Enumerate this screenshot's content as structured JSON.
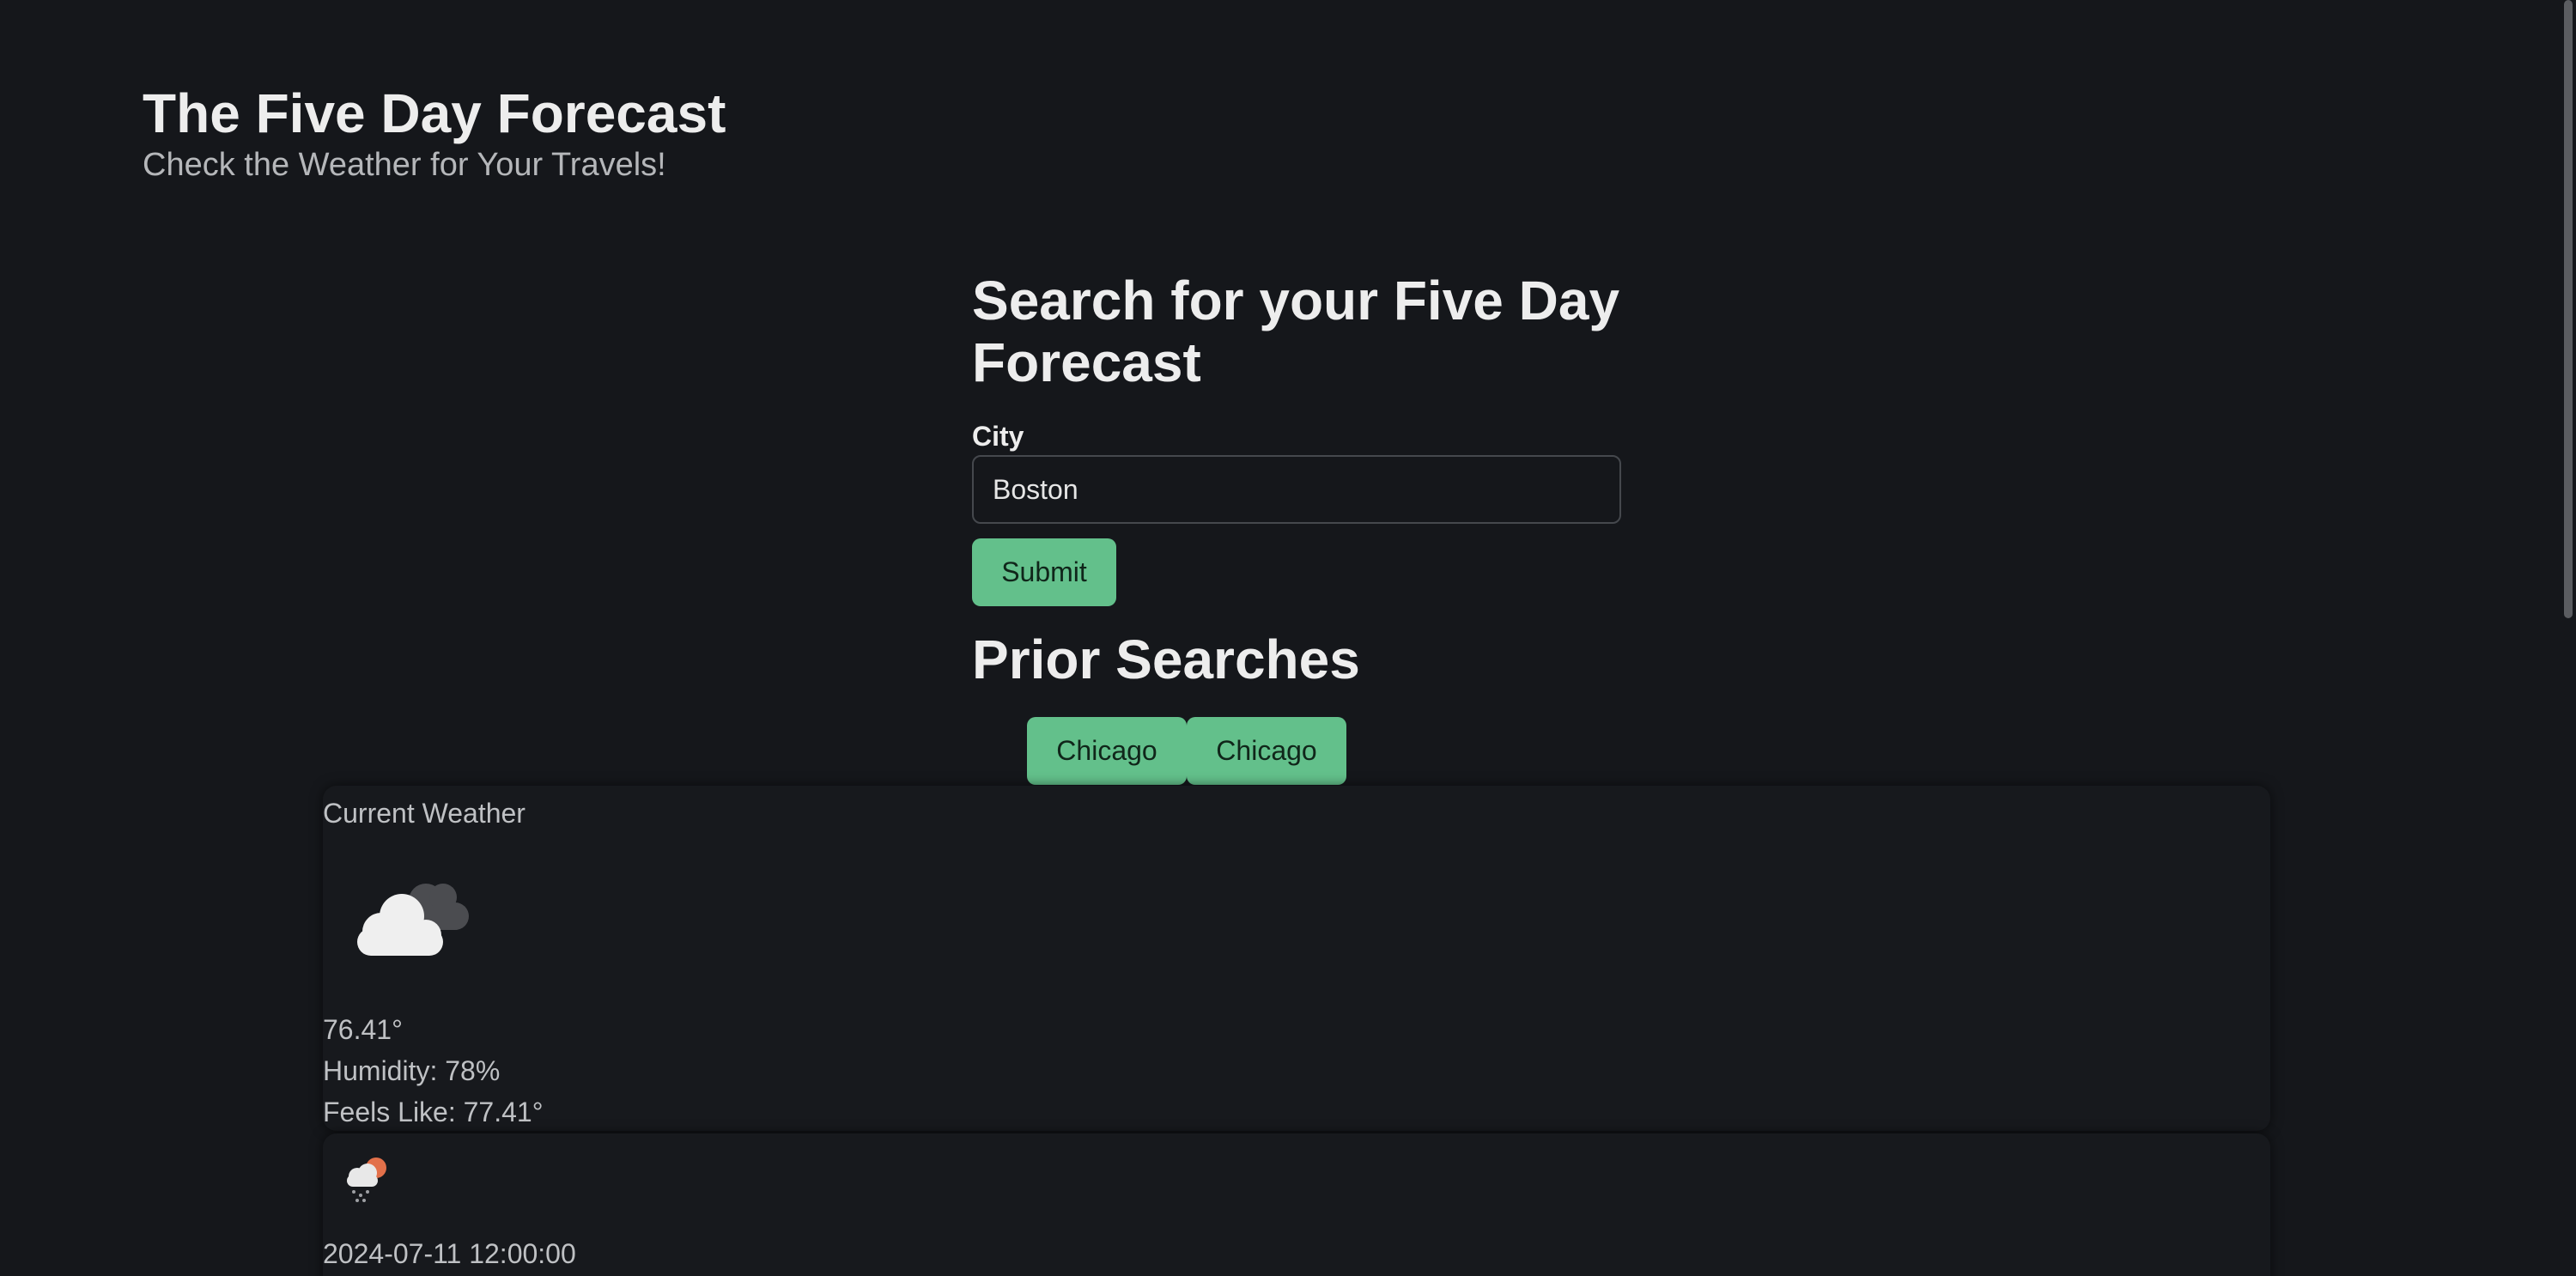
{
  "header": {
    "title": "The Five Day Forecast",
    "subtitle": "Check the Weather for Your Travels!"
  },
  "search": {
    "heading": "Search for your Five Day Forecast",
    "city_label": "City",
    "city_value": "Boston",
    "submit_label": "Submit"
  },
  "prior_searches": {
    "heading": "Prior Searches",
    "items": [
      "Chicago",
      "Chicago"
    ]
  },
  "current_weather": {
    "title": "Current Weather",
    "icon": "cloudy-icon",
    "temperature": "76.41°",
    "humidity": "Humidity: 78%",
    "feels_like": "Feels Like: 77.41°"
  },
  "forecast": [
    {
      "icon": "rain-sun-icon",
      "datetime": "2024-07-11 12:00:00"
    }
  ],
  "colors": {
    "background": "#15171b",
    "accent": "#63c08b",
    "text": "#ededed",
    "muted_text": "#bfc1c4"
  }
}
